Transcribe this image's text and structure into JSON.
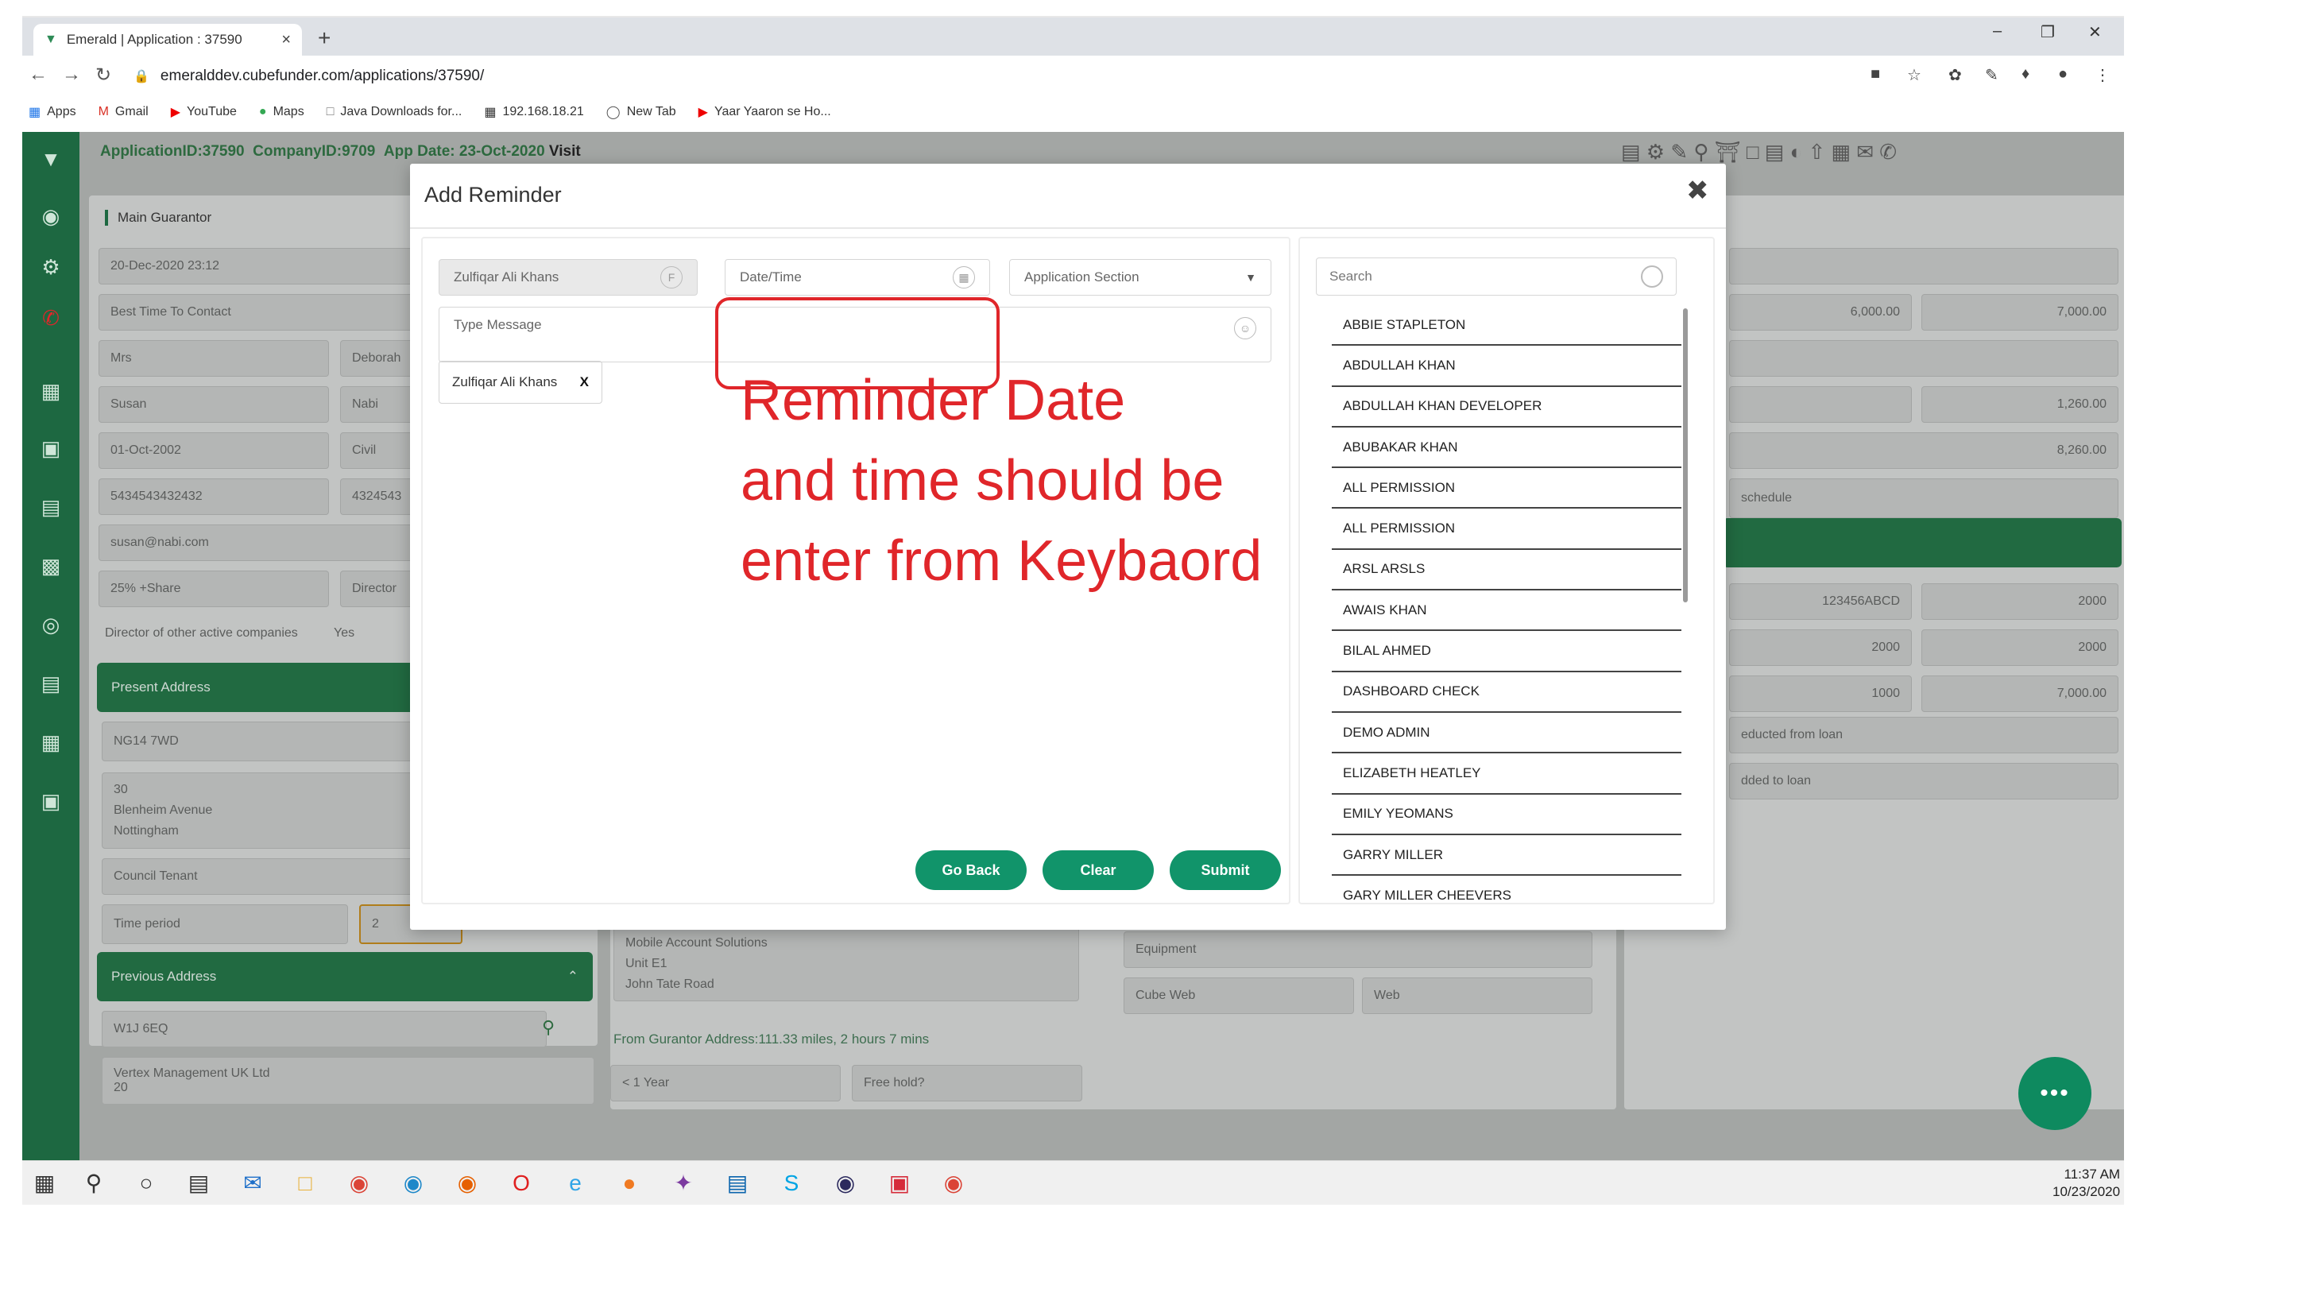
{
  "browser": {
    "tab_title": "Emerald | Application : 37590",
    "url": "emeralddev.cubefunder.com/applications/37590/",
    "bookmarks": [
      "Apps",
      "Gmail",
      "YouTube",
      "Maps",
      "Java Downloads for...",
      "192.168.18.21",
      "New Tab",
      "Yaar Yaaron se Ho..."
    ]
  },
  "app": {
    "header": {
      "application_id": "ApplicationID:37590",
      "company_id": "CompanyID:9709",
      "app_date": "App Date: 23-Oct-2020",
      "visit": "Visit"
    },
    "background": {
      "main_guarantor": "Main Guarantor",
      "datetime": "20-Dec-2020 23:12",
      "best_time": "Best Time To Contact",
      "title": "Mrs",
      "first_name": "Susan",
      "middle_name": "Deborah",
      "last_name": "Nabi",
      "dob": "01-Oct-2002",
      "status": "Civil",
      "phone1": "5434543432432",
      "phone2": "4324543",
      "email": "susan@nabi.com",
      "share": "25% +Share",
      "director": "Director",
      "director_q": "Director of other active companies",
      "yes": "Yes",
      "present_address": "Present Address",
      "postcode": "NG14 7WD",
      "address_lines": [
        "30",
        "Blenheim Avenue",
        "Nottingham"
      ],
      "tenancy": "Council Tenant",
      "time_period": "Time period",
      "time_value": "2",
      "previous_address": "Previous Address",
      "prev_postcode": "W1J 6EQ",
      "prev_company": "Vertex Management UK Ltd",
      "prev_line": "20",
      "company_addr": [
        "Mobile Account Solutions",
        "Unit E1",
        "John Tate Road"
      ],
      "distance": "From Gurantor Address:111.33 miles, 2 hours 7 mins",
      "duration": "< 1 Year",
      "freehold": "Free hold?",
      "equipment": "Equipment",
      "cube_web": "Cube Web",
      "web": "Web",
      "amounts": [
        "6,000.00",
        "7,000.00",
        "1,260.00",
        "8,260.00"
      ],
      "schedule": "schedule",
      "ref": "123456ABCD",
      "vals": [
        "2000",
        "2000",
        "2000",
        "1000",
        "7,000.00"
      ],
      "deducted": "educted from loan",
      "added": "dded to loan"
    }
  },
  "modal": {
    "title": "Add Reminder",
    "assigned_user": "Zulfiqar Ali Khans",
    "datetime_placeholder": "Date/Time",
    "section_placeholder": "Application Section",
    "message_placeholder": "Type Message",
    "chip_label": "Zulfiqar Ali Khans",
    "chip_remove": "X",
    "annotation_lines": [
      "Reminder Date",
      "and time should be",
      "enter from Keybaord"
    ],
    "buttons": {
      "go_back": "Go Back",
      "clear": "Clear",
      "submit": "Submit"
    },
    "search_placeholder": "Search",
    "users": [
      "ABBIE STAPLETON",
      "ABDULLAH KHAN",
      "ABDULLAH KHAN DEVELOPER",
      "ABUBAKAR KHAN",
      "ALL PERMISSION",
      "ALL PERMISSION",
      "ARSL ARSLS",
      "AWAIS KHAN",
      "BILAL AHMED",
      "DASHBOARD CHECK",
      "DEMO ADMIN",
      "ELIZABETH HEATLEY",
      "EMILY YEOMANS",
      "GARRY MILLER",
      "GARY MILLER CHEEVERS"
    ]
  },
  "taskbar": {
    "time": "11:37 AM",
    "date": "10/23/2020"
  },
  "colors": {
    "brand_green": "#1d6841",
    "button_green": "#11946a",
    "annotation_red": "#e0262a"
  }
}
